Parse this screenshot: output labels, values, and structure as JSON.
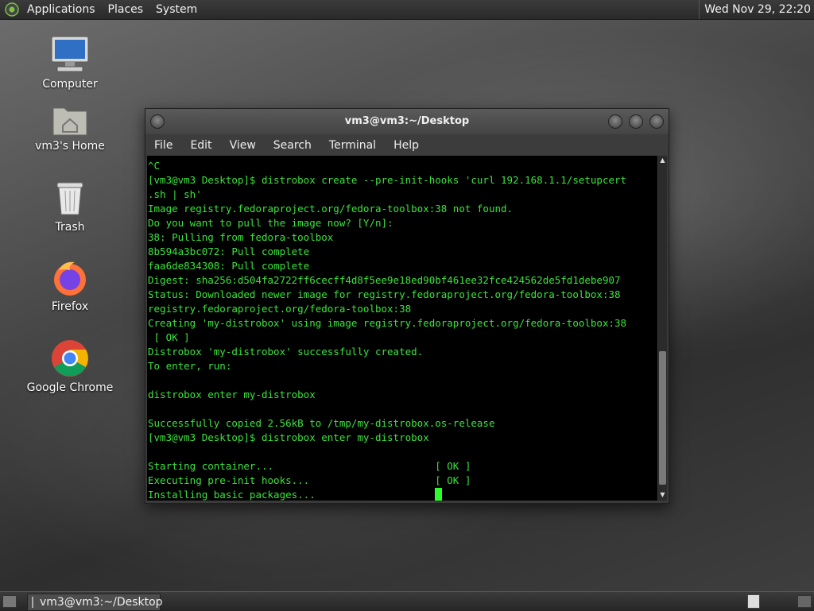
{
  "top_panel": {
    "menus": [
      "Applications",
      "Places",
      "System"
    ],
    "clock": "Wed Nov 29, 22:20"
  },
  "desktop_icons": [
    {
      "label": "Computer",
      "icon": "computer-icon"
    },
    {
      "label": "vm3's Home",
      "icon": "home-folder-icon"
    },
    {
      "label": "Trash",
      "icon": "trash-icon"
    },
    {
      "label": "Firefox",
      "icon": "firefox-icon"
    },
    {
      "label": "Google Chrome",
      "icon": "chrome-icon"
    }
  ],
  "terminal": {
    "title": "vm3@vm3:~/Desktop",
    "menu": [
      "File",
      "Edit",
      "View",
      "Search",
      "Terminal",
      "Help"
    ],
    "lines": [
      "^C",
      "[vm3@vm3 Desktop]$ distrobox create --pre-init-hooks 'curl 192.168.1.1/setupcert",
      ".sh | sh'",
      "Image registry.fedoraproject.org/fedora-toolbox:38 not found.",
      "Do you want to pull the image now? [Y/n]:",
      "38: Pulling from fedora-toolbox",
      "8b594a3bc072: Pull complete",
      "faa6de834308: Pull complete",
      "Digest: sha256:d504fa2722ff6cecff4d8f5ee9e18ed90bf461ee32fce424562de5fd1debe907",
      "Status: Downloaded newer image for registry.fedoraproject.org/fedora-toolbox:38",
      "registry.fedoraproject.org/fedora-toolbox:38",
      "Creating 'my-distrobox' using image registry.fedoraproject.org/fedora-toolbox:38",
      " [ OK ]",
      "Distrobox 'my-distrobox' successfully created.",
      "To enter, run:",
      "",
      "distrobox enter my-distrobox",
      "",
      "Successfully copied 2.56kB to /tmp/my-distrobox.os-release",
      "[vm3@vm3 Desktop]$ distrobox enter my-distrobox",
      "",
      "Starting container...                           [ OK ]",
      "Executing pre-init hooks...                     [ OK ]",
      "Installing basic packages...                    "
    ]
  },
  "taskbar": {
    "window_button": "vm3@vm3:~/Desktop"
  }
}
